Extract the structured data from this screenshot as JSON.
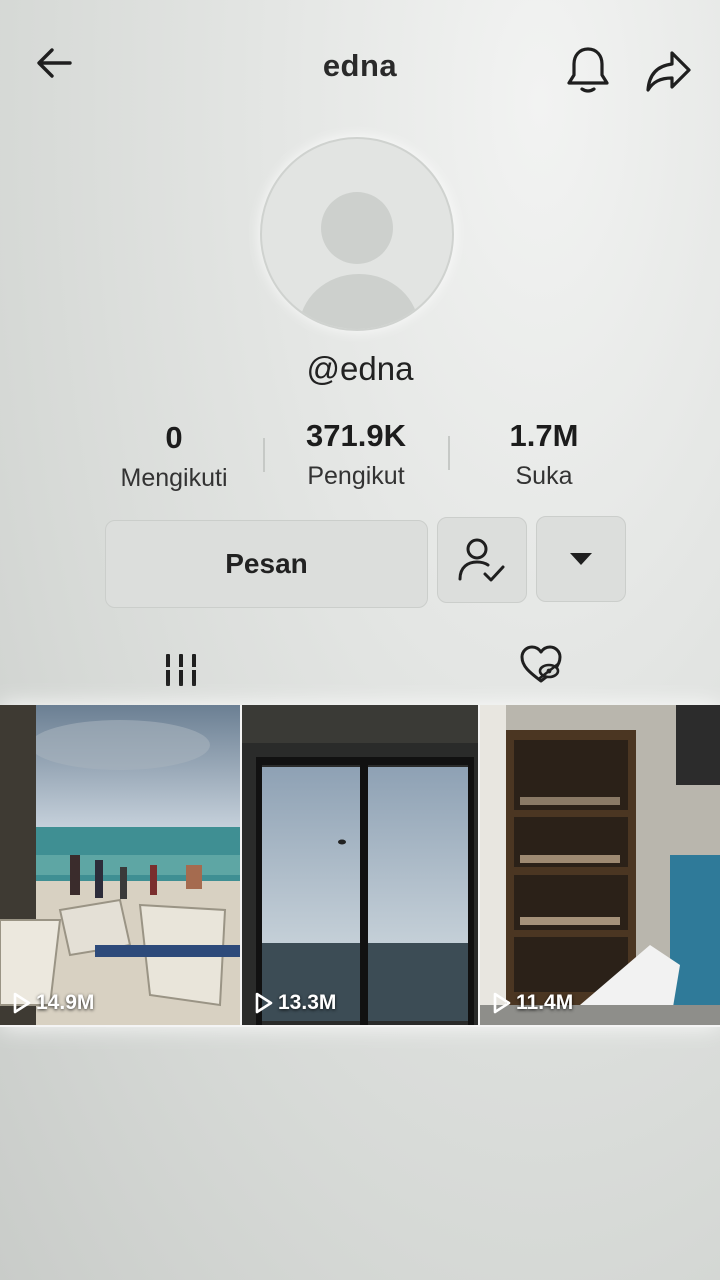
{
  "header": {
    "title": "edna",
    "back_icon": "arrow-left-icon",
    "bell_icon": "bell-icon",
    "share_icon": "share-arrow-icon"
  },
  "profile": {
    "handle": "@edna",
    "avatar_icon": "default-avatar-icon"
  },
  "stats": {
    "following": {
      "value": "0",
      "label": "Mengikuti"
    },
    "followers": {
      "value": "371.9K",
      "label": "Pengikut"
    },
    "likes": {
      "value": "1.7M",
      "label": "Suka"
    }
  },
  "actions": {
    "message_label": "Pesan",
    "friend_icon": "user-check-icon",
    "more_icon": "caret-down-icon"
  },
  "tabs": {
    "videos_icon": "grid-bars-icon",
    "liked_icon": "heart-hidden-icon"
  },
  "videos": [
    {
      "views": "14.9M",
      "scene": "beach"
    },
    {
      "views": "13.3M",
      "scene": "window-ocean"
    },
    {
      "views": "11.4M",
      "scene": "shoe-shelf"
    }
  ],
  "colors": {
    "background": "#d9dcd9",
    "button": "#dcdedc",
    "text": "#1f1f1f"
  }
}
